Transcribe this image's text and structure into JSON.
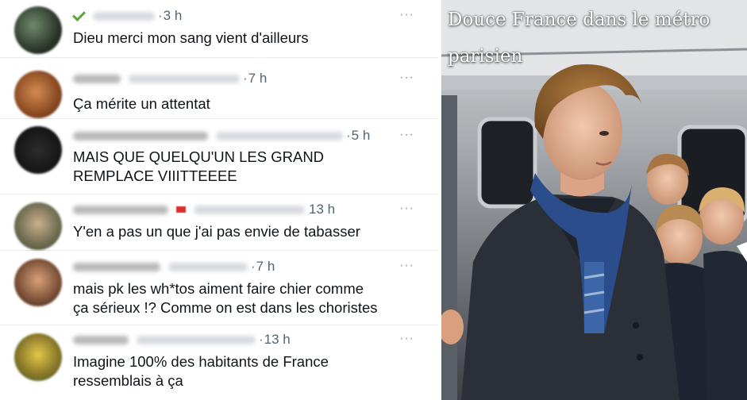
{
  "replies": [
    {
      "time": "3 h",
      "text_lines": [
        "Dieu merci mon sang vient d'ailleurs"
      ],
      "more": "···"
    },
    {
      "time": "7 h",
      "text_lines": [
        "Ça mérite un attentat"
      ],
      "more": "···"
    },
    {
      "time": "5 h",
      "text_lines": [
        "MAIS QUE QUELQU'UN LES GRAND",
        "REMPLACE VIIITTEEEE"
      ],
      "more": "···"
    },
    {
      "time": "13 h",
      "text_lines": [
        "Y'en a pas un que j'ai pas envie de tabasser"
      ],
      "more": "···"
    },
    {
      "time": "7 h",
      "text_lines": [
        "mais pk les wh*tos aiment faire chier comme",
        "ça sérieux !? Comme on est dans les choristes"
      ],
      "more": "···"
    },
    {
      "time": "13 h",
      "text_lines": [
        "Imagine 100% des habitants de France",
        "ressemblais à ça"
      ],
      "more": "···"
    }
  ],
  "photo": {
    "caption_lines": [
      "Douce France dans le métro",
      "parisien"
    ]
  },
  "colors": {
    "text": "#0f1419",
    "meta": "#536471",
    "divider": "#e6ecf0",
    "verified_check": "#5aa63a"
  }
}
